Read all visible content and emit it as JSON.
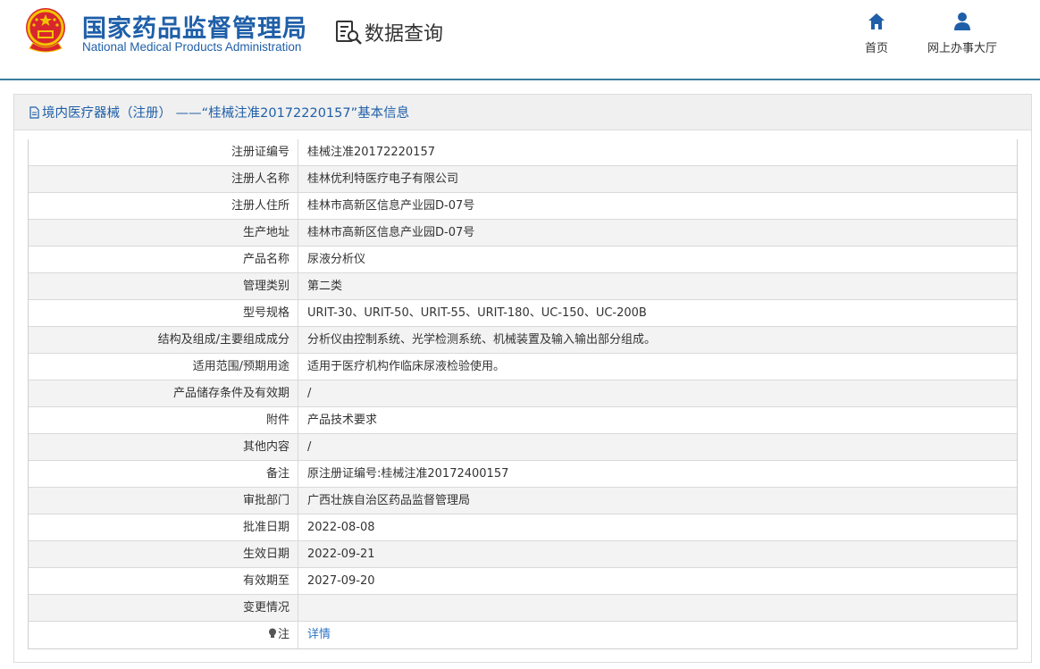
{
  "header": {
    "logo_cn": "国家药品监督管理局",
    "logo_en": "National Medical Products Administration",
    "query_label": "数据查询",
    "nav": [
      {
        "label": "首页",
        "icon": "home-icon"
      },
      {
        "label": "网上办事大厅",
        "icon": "user-icon"
      }
    ]
  },
  "panel": {
    "title": "境内医疗器械（注册） ——“桂械注准20172220157”基本信息"
  },
  "rows": [
    {
      "label": "注册证编号",
      "value": "桂械注准20172220157"
    },
    {
      "label": "注册人名称",
      "value": "桂林优利特医疗电子有限公司"
    },
    {
      "label": "注册人住所",
      "value": "桂林市高新区信息产业园D-07号"
    },
    {
      "label": "生产地址",
      "value": "桂林市高新区信息产业园D-07号"
    },
    {
      "label": "产品名称",
      "value": "尿液分析仪"
    },
    {
      "label": "管理类别",
      "value": "第二类"
    },
    {
      "label": "型号规格",
      "value": "URIT-30、URIT-50、URIT-55、URIT-180、UC-150、UC-200B"
    },
    {
      "label": "结构及组成/主要组成成分",
      "value": "分析仪由控制系统、光学检测系统、机械装置及输入输出部分组成。"
    },
    {
      "label": "适用范围/预期用途",
      "value": "适用于医疗机构作临床尿液检验使用。"
    },
    {
      "label": "产品储存条件及有效期",
      "value": "/"
    },
    {
      "label": "附件",
      "value": "产品技术要求"
    },
    {
      "label": "其他内容",
      "value": "/"
    },
    {
      "label": "备注",
      "value": "原注册证编号:桂械注准20172400157"
    },
    {
      "label": "审批部门",
      "value": "广西壮族自治区药品监督管理局"
    },
    {
      "label": "批准日期",
      "value": "2022-08-08"
    },
    {
      "label": "生效日期",
      "value": "2022-09-21"
    },
    {
      "label": "有效期至",
      "value": "2027-09-20"
    },
    {
      "label": "变更情况",
      "value": ""
    }
  ],
  "note_row": {
    "label": "注",
    "link": "详情",
    "icon": "bulb-icon"
  },
  "colors": {
    "brand": "#1f5fa8",
    "link": "#2c74c4",
    "rule": "#3a7f9c"
  }
}
